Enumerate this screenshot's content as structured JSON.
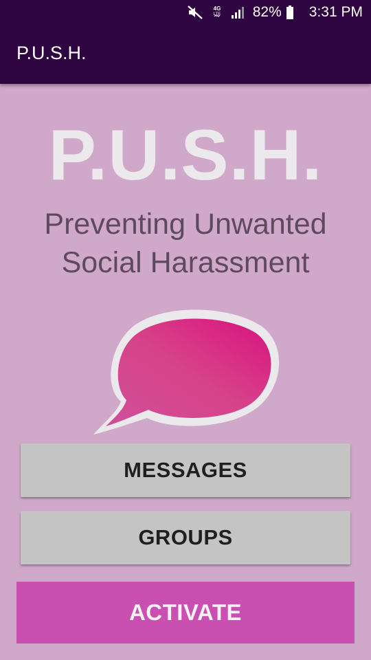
{
  "status_bar": {
    "network_label": "4G LTE",
    "battery_percent": "82%",
    "time": "3:31 PM",
    "icons": [
      "mute-icon",
      "network-icon",
      "signal-icon",
      "battery-icon"
    ]
  },
  "app_bar": {
    "title": "P.U.S.H."
  },
  "main": {
    "hero_title": "P.U.S.H.",
    "subtitle_line1": "Preventing Unwanted",
    "subtitle_line2": "Social Harassment",
    "logo_icon": "speech-bubble-icon"
  },
  "buttons": {
    "messages": "MESSAGES",
    "groups": "GROUPS",
    "activate": "ACTIVATE"
  },
  "colors": {
    "app_bar": "#2e0441",
    "background": "#d0a9ca",
    "button_gray": "#c3c4c3",
    "activate": "#c94fb1",
    "bubble_fill": "#d9147f"
  }
}
